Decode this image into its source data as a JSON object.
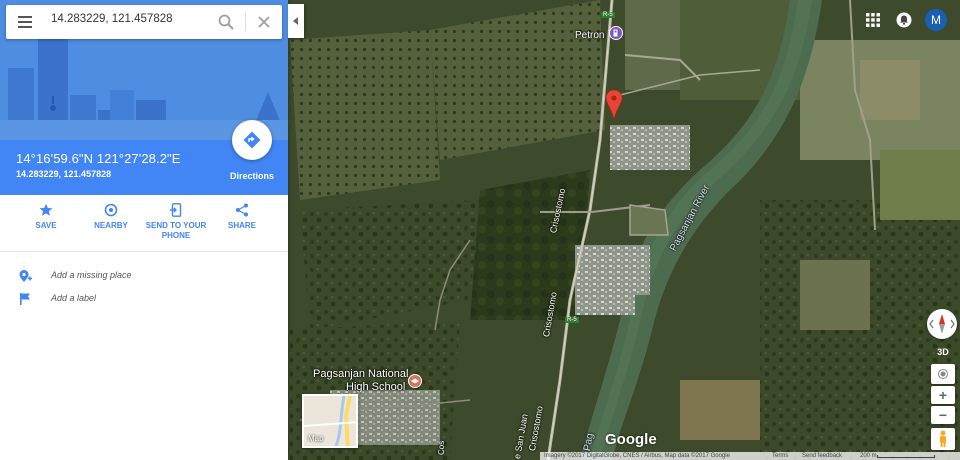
{
  "search": {
    "query": "14.283229, 121.457828"
  },
  "place": {
    "dms": "14°16'59.6\"N 121°27'28.2\"E",
    "decimal": "14.283229, 121.457828",
    "directions_label": "Directions"
  },
  "actions": [
    {
      "label_line1": "SAVE",
      "label_line2": ""
    },
    {
      "label_line1": "NEARBY",
      "label_line2": ""
    },
    {
      "label_line1": "SEND TO YOUR",
      "label_line2": "PHONE"
    },
    {
      "label_line1": "SHARE",
      "label_line2": ""
    }
  ],
  "links": {
    "add_place": "Add a missing place",
    "add_label": "Add a label"
  },
  "map": {
    "labels": {
      "petron": "Petron",
      "crisostomo_north": "Crisostomo",
      "crisostomo_south": "Crisostomo",
      "crisostomo_bottom": "Crisostomo",
      "river": "Pagsanjan River",
      "school_line1": "Pagsanjan National",
      "school_line2": "High School",
      "san_juan": "e San Juan",
      "pag": "Pag",
      "cos": "Cos",
      "route_shield": "R-5"
    },
    "minimap_label": "Map",
    "logo": "Google",
    "attribution": {
      "imagery": "Imagery ©2017 DigitalGlobe, CNES / Airbus, Map data ©2017 Google",
      "terms": "Terms",
      "feedback": "Send feedback",
      "scale": "200 m"
    },
    "zoom_in": "+",
    "zoom_out": "−",
    "tilt": "3D"
  },
  "user": {
    "avatar_initial": "M"
  },
  "colors": {
    "accent": "#4285f4",
    "pin": "#ea4335",
    "avatar": "#1a5fb4"
  }
}
